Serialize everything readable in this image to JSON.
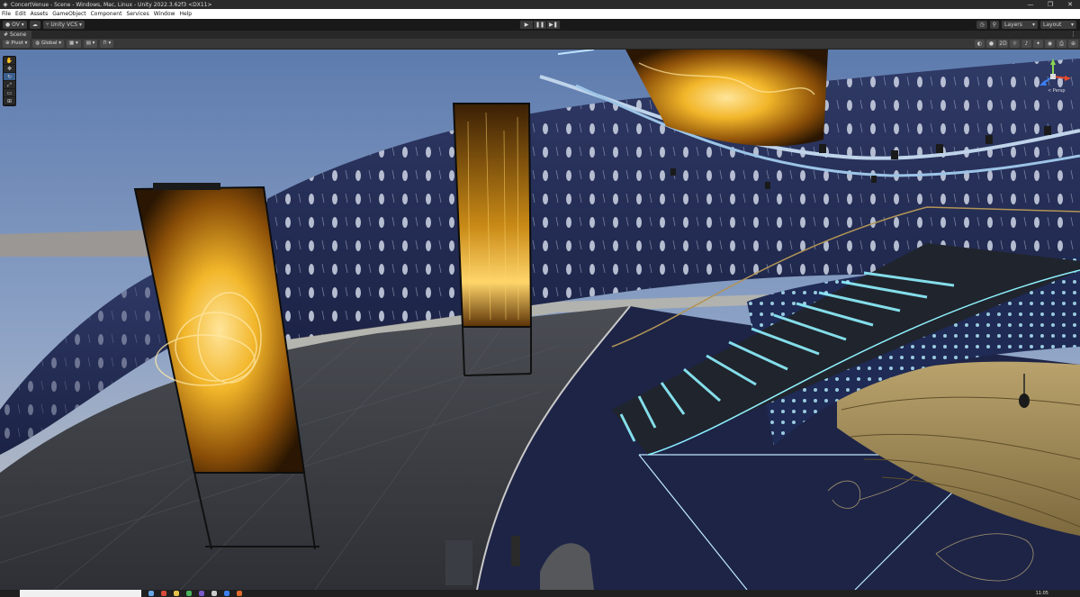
{
  "window": {
    "title": "ConcertVenue - Scene - Windows, Mac, Linux - Unity 2022.3.62f3 <DX11>",
    "controls": [
      "—",
      "❐",
      "✕"
    ]
  },
  "menu": [
    "File",
    "Edit",
    "Assets",
    "GameObject",
    "Component",
    "Services",
    "Window",
    "Help"
  ],
  "toolbar": {
    "account": "OV",
    "vcs": "Unity VCS",
    "layers": "Layers",
    "layout": "Layout"
  },
  "scene_tab": {
    "label": "Scene"
  },
  "scene_toolbar": {
    "pivot": "Pivot",
    "global": "Global",
    "mode_2d": "2D"
  },
  "gizmo": {
    "persp_label": "< Persp"
  },
  "taskbar": {
    "clock": "11:05"
  },
  "colors": {
    "accent": "#3a5f8f",
    "sky_top": "#5d7bae",
    "sky_bottom": "#c8c6c4",
    "floor": "#3b3e44",
    "stage_floor": "#1d2446",
    "wall": "#27305a",
    "screen_gold": "#f2b62a",
    "stair_glow": "#8ff2ff",
    "wood": "#a9935f"
  }
}
